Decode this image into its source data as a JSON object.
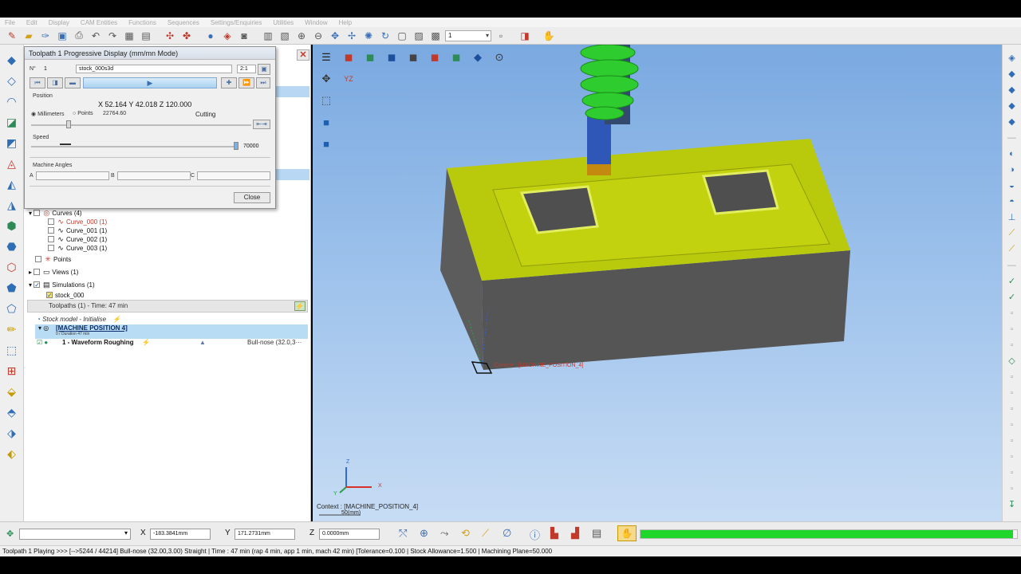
{
  "menu": [
    "File",
    "Edit",
    "Display",
    "CAM Entities",
    "Functions",
    "Sequences",
    "Settings/Enquiries",
    "Utilities",
    "Window",
    "Help"
  ],
  "toolbar": {
    "combo_value": "1"
  },
  "dialog": {
    "title": "Toolpath 1 Progressive Display (mm/mn Mode)",
    "n_label": "N°",
    "n_value": "1",
    "stock_value": "stock_000s3d",
    "ratio_value": "2:1",
    "position_label": "Position",
    "xyz": "X 52.164 Y 42.018 Z 120.000",
    "millimeters_label": "Millimeters",
    "points_label": "Points",
    "points_value": "22764.60",
    "state": "Cutting",
    "speed_label": "Speed",
    "speed_value": "70000",
    "machine_angles_label": "Machine Angles",
    "a_label": "A",
    "b_label": "B",
    "c_label": "C",
    "close_label": "Close"
  },
  "tree": {
    "curves": "Curves (4)",
    "curve_items": [
      "Curve_000 (1)",
      "Curve_001 (1)",
      "Curve_002 (1)",
      "Curve_003 (1)"
    ],
    "points": "Points",
    "views": "Views (1)",
    "simulations": "Simulations (1)",
    "stock": "stock_000",
    "toolpaths": "Toolpaths (1) - Time: 47 min",
    "stock_model": "Stock model - Initialise",
    "machine_position": "[MACHINE POSITION 4]",
    "machine_position_sub": "0 / Duration 47 min",
    "operation": "1 - Waveform Roughing",
    "tool": "Bull-nose (32.0,3···"
  },
  "viewport": {
    "context_tag": "Context : [MACHINE_POSITION_4]",
    "context_bottom": "Context : [MACHINE_POSITION_4]",
    "scale": "50(mm)",
    "axis_x": "X",
    "axis_y": "Y",
    "axis_z": "Z"
  },
  "coords": {
    "x_label": "X",
    "x_value": "-183.3841mm",
    "y_label": "Y",
    "y_value": "171.2731mm",
    "z_label": "Z",
    "z_value": "0.0000mm",
    "progress_fraction": 0.99
  },
  "status": "Toolpath 1   Playing >>> [-->5244 / 44214]  Bull-nose (32.00,3.00) Straight | Time : 47 min (rap 4 min, app 1 min, mach 42 min) [Tolerance=0.100 | Stock Allowance=1.500 | Machining Plane=50.000",
  "colors": {
    "part_top": "#b9c90b",
    "part_side": "#555555",
    "spindle": "#2ecc2e",
    "tool_body": "#2e57b8",
    "progress": "#1fd62a"
  }
}
